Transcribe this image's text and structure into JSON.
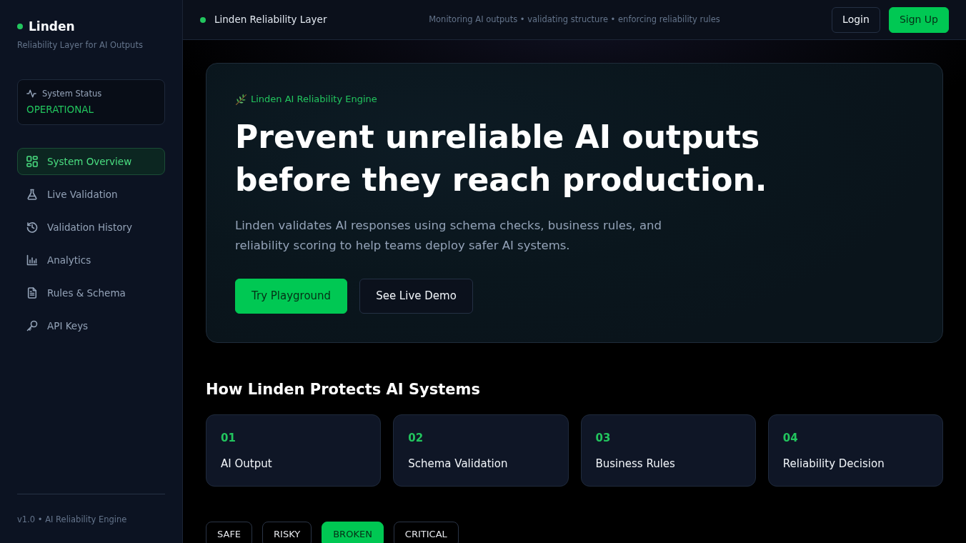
{
  "sidebar": {
    "brand": "Linden",
    "tagline": "Reliability Layer for AI Outputs",
    "status": {
      "label": "System Status",
      "value": "OPERATIONAL"
    },
    "items": [
      {
        "label": "System Overview",
        "selected": true
      },
      {
        "label": "Live Validation",
        "selected": false
      },
      {
        "label": "Validation History",
        "selected": false
      },
      {
        "label": "Analytics",
        "selected": false
      },
      {
        "label": "Rules & Schema",
        "selected": false
      },
      {
        "label": "API Keys",
        "selected": false
      }
    ],
    "footer": "v1.0 • AI Reliability Engine"
  },
  "topbar": {
    "title": "Linden Reliability Layer",
    "tagline": "Monitoring AI outputs • validating structure • enforcing reliability rules",
    "buttons": [
      {
        "label": "Login",
        "kind": "outline"
      },
      {
        "label": "Sign Up",
        "kind": "primary"
      }
    ]
  },
  "hero": {
    "eyebrow": "Linden AI Reliability Engine",
    "headline": "Prevent unreliable AI outputs before they reach production.",
    "description": "Linden validates AI responses using schema checks, business rules, and reliability scoring to help teams deploy safer AI systems.",
    "buttons": [
      {
        "label": "Try Playground",
        "kind": "primary"
      },
      {
        "label": "See Live Demo",
        "kind": "outline"
      }
    ]
  },
  "steps": {
    "title": "How Linden Protects AI Systems",
    "items": [
      {
        "number": "01",
        "title": "AI Output"
      },
      {
        "number": "02",
        "title": "Schema Validation"
      },
      {
        "number": "03",
        "title": "Business Rules"
      },
      {
        "number": "04",
        "title": "Reliability Decision"
      }
    ]
  },
  "filters": {
    "items": [
      {
        "label": "SAFE",
        "selected": false
      },
      {
        "label": "RISKY",
        "selected": false
      },
      {
        "label": "BROKEN",
        "selected": true
      },
      {
        "label": "CRITICAL",
        "selected": false
      }
    ]
  }
}
